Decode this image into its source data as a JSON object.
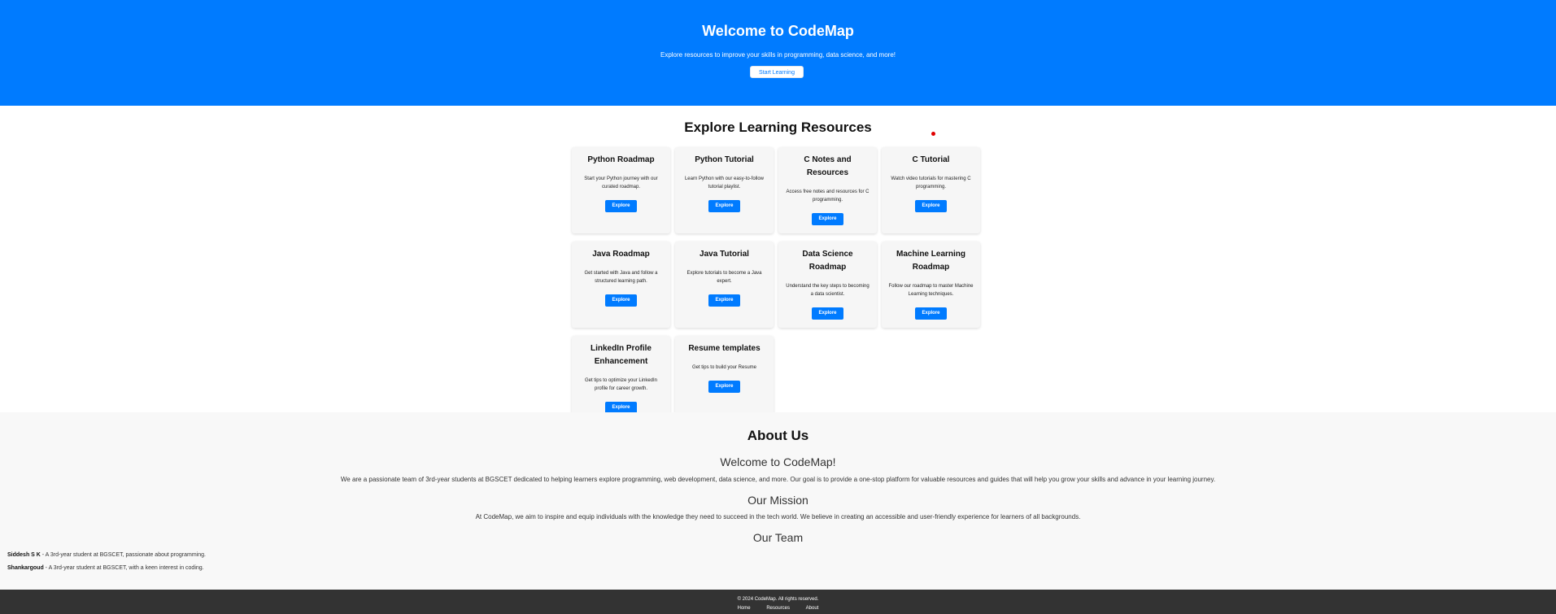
{
  "hero": {
    "title": "Welcome to CodeMap",
    "subtitle": "Explore resources to improve your skills in programming, data science, and more!",
    "button_label": "Start Learning"
  },
  "resources": {
    "title": "Explore Learning Resources",
    "cards": [
      {
        "title": "Python Roadmap",
        "description": "Start your Python journey with our curated roadmap.",
        "button": "Explore"
      },
      {
        "title": "Python Tutorial",
        "description": "Learn Python with our easy-to-follow tutorial playlist.",
        "button": "Explore"
      },
      {
        "title": "C Notes and Resources",
        "description": "Access free notes and resources for C programming.",
        "button": "Explore"
      },
      {
        "title": "C Tutorial",
        "description": "Watch video tutorials for mastering C programming.",
        "button": "Explore"
      },
      {
        "title": "Java Roadmap",
        "description": "Get started with Java and follow a structured learning path.",
        "button": "Explore"
      },
      {
        "title": "Java Tutorial",
        "description": "Explore tutorials to become a Java expert.",
        "button": "Explore"
      },
      {
        "title": "Data Science Roadmap",
        "description": "Understand the key steps to becoming a data scientist.",
        "button": "Explore"
      },
      {
        "title": "Machine Learning Roadmap",
        "description": "Follow our roadmap to master Machine Learning techniques.",
        "button": "Explore"
      },
      {
        "title": "LinkedIn Profile Enhancement",
        "description": "Get tips to optimize your LinkedIn profile for career growth.",
        "button": "Explore"
      },
      {
        "title": "Resume templates",
        "description": "Get tips to build your Resume",
        "button": "Explore"
      }
    ]
  },
  "about": {
    "title": "About Us",
    "welcome_heading": "Welcome to CodeMap!",
    "intro": "We are a passionate team of 3rd-year students at BGSCET dedicated to helping learners explore programming, web development, data science, and more. Our goal is to provide a one-stop platform for valuable resources and guides that will help you grow your skills and advance in your learning journey.",
    "mission_heading": "Our Mission",
    "mission": "At CodeMap, we aim to inspire and equip individuals with the knowledge they need to succeed in the tech world. We believe in creating an accessible and user-friendly experience for learners of all backgrounds.",
    "team_heading": "Our Team",
    "team": [
      {
        "name": "Siddesh S K",
        "role": " - A 3rd-year student at BGSCET, passionate about programming."
      },
      {
        "name": "Shankargoud",
        "role": " - A 3rd-year student at BGSCET, with a keen interest in coding."
      }
    ]
  },
  "footer": {
    "copyright": "© 2024 CodeMap. All rights reserved.",
    "links": [
      "Home",
      "Resources",
      "About"
    ]
  },
  "colors": {
    "primary": "#007bff",
    "footer_bg": "#333333",
    "about_bg": "#f8f8f8",
    "card_bg": "#f6f6f6",
    "marker": "#e00000"
  }
}
